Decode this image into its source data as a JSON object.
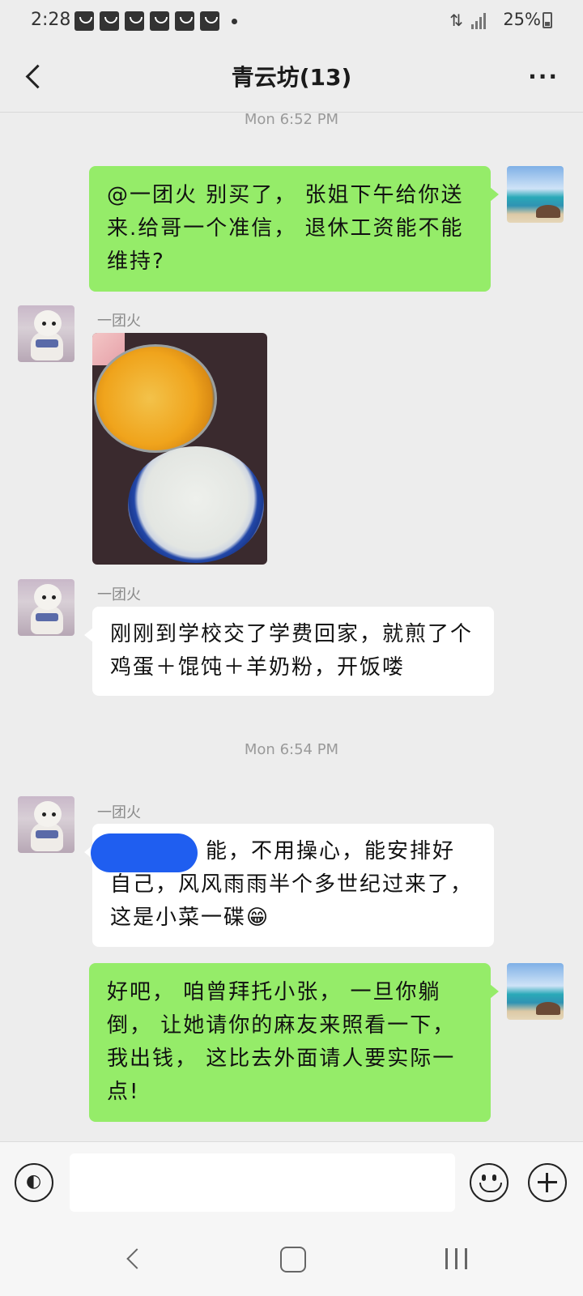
{
  "status_bar": {
    "time": "2:28",
    "battery": "25%",
    "notification_icons": [
      "app-notification-icon",
      "app-notification-icon",
      "app-notification-icon",
      "app-notification-icon",
      "app-notification-icon",
      "app-notification-icon"
    ]
  },
  "header": {
    "title": "青云坊(13)"
  },
  "chat": {
    "messages": [
      {
        "type": "timestamp",
        "text": "Mon 6:52 PM"
      },
      {
        "type": "text",
        "side": "right",
        "text": "@一团火  别买了， 张姐下午给你送来.给哥一个准信， 退休工资能不能维持?"
      },
      {
        "type": "image",
        "side": "left",
        "sender": "一团火",
        "image_desc_icon": "food-photo"
      },
      {
        "type": "text",
        "side": "left",
        "sender": "一团火",
        "text": "刚刚到学校交了学费回家，就煎了个鸡蛋＋馄饨＋羊奶粉，开饭喽"
      },
      {
        "type": "timestamp",
        "text": "Mon 6:54 PM"
      },
      {
        "type": "text",
        "side": "left",
        "sender": "一团火",
        "text": "能，不用操心，能安排好自己，风风雨雨半个多世纪过来了，这是小菜一碟😁"
      },
      {
        "type": "text",
        "side": "right",
        "text": "好吧， 咱曾拜托小张， 一旦你躺倒， 让她请你的麻友来照看一下， 我出钱， 这比去外面请人要实际一点!"
      }
    ]
  },
  "colors": {
    "background": "#ededed",
    "sent_bubble": "#95ec69",
    "received_bubble": "#ffffff",
    "redaction": "#1f5ef0"
  }
}
